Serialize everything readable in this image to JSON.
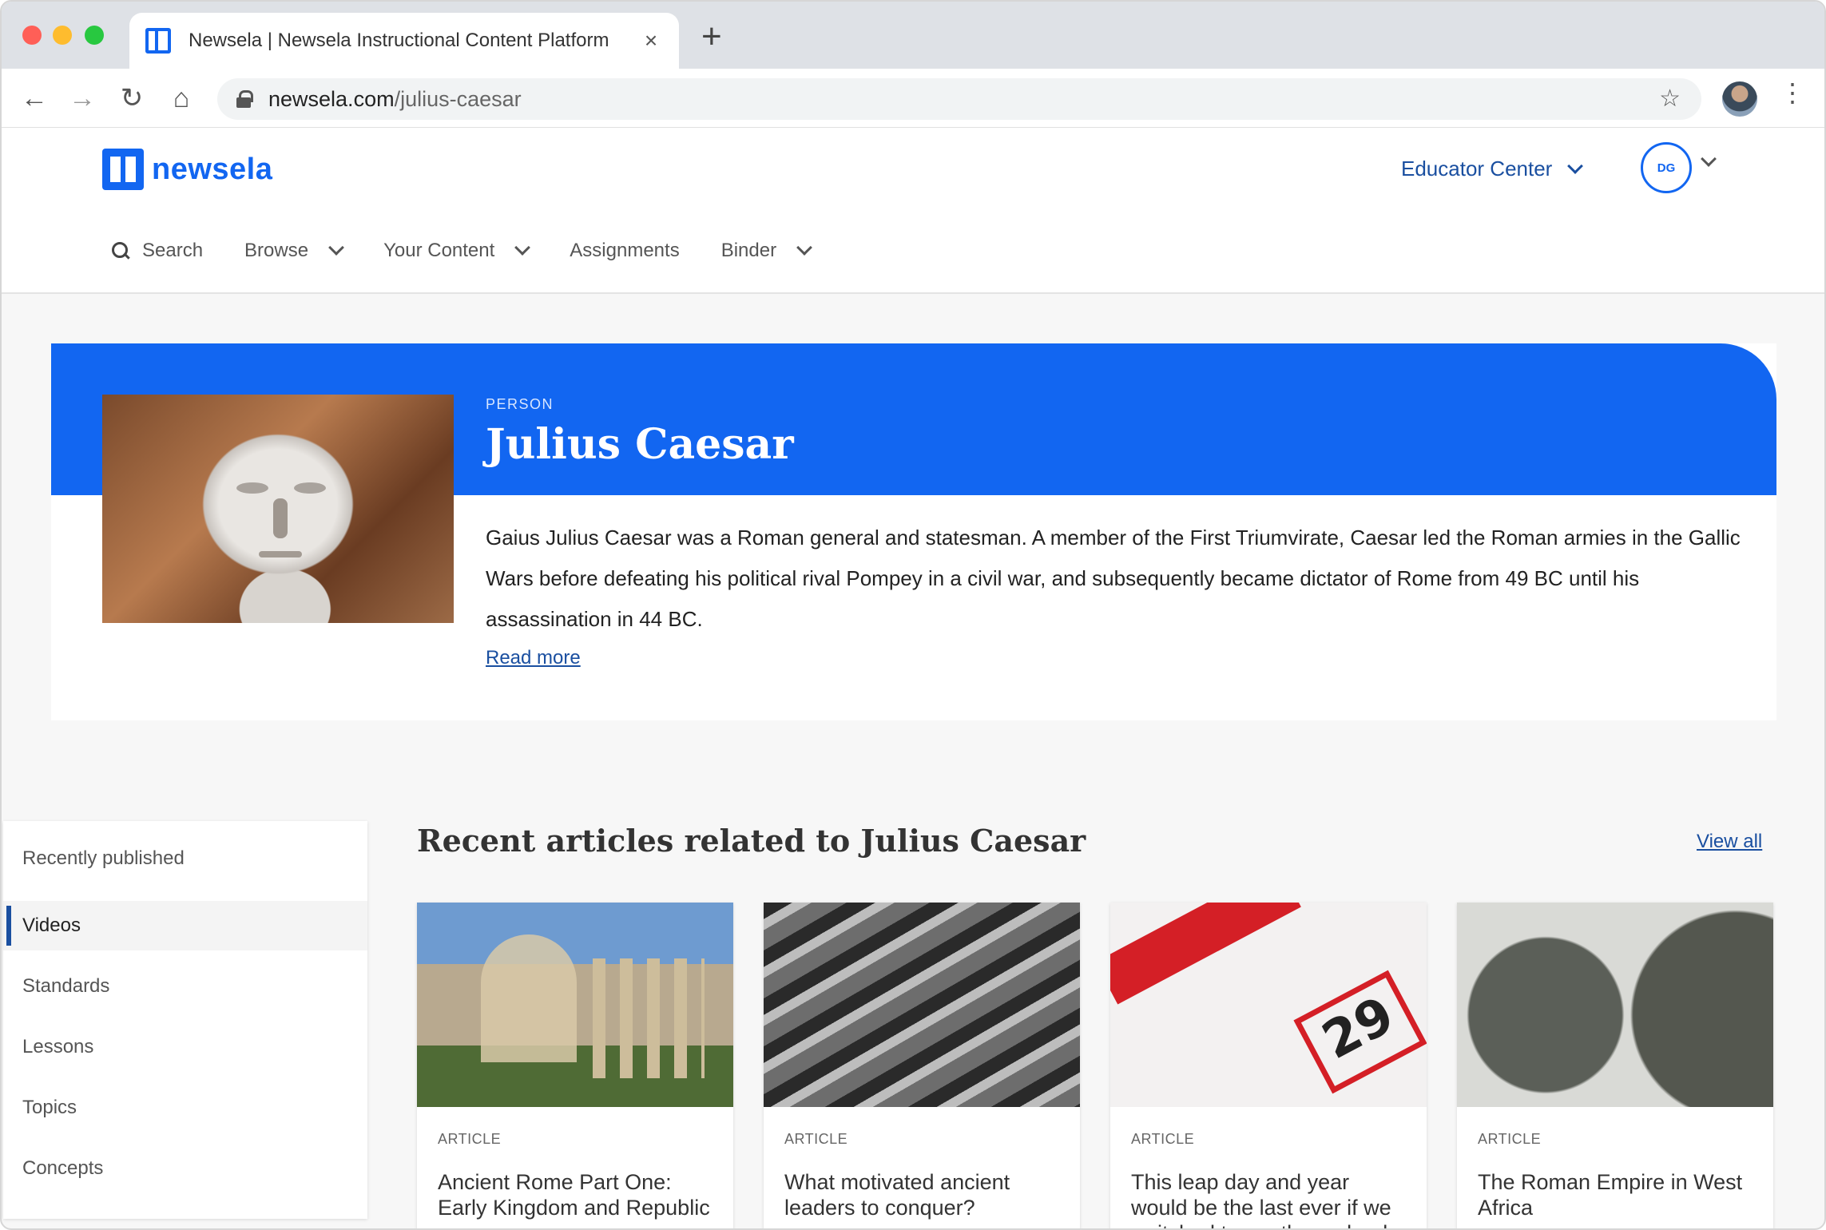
{
  "browser": {
    "tab_title": "Newsela | Newsela Instructional Content Platform",
    "tab_close": "×",
    "new_tab": "+",
    "url_host": "newsela.com",
    "url_path": "/julius-caesar"
  },
  "header": {
    "logo_text": "newsela",
    "educator_center": "Educator Center",
    "avatar_initials": "DG",
    "nav": {
      "search": "Search",
      "browse": "Browse",
      "your_content": "Your Content",
      "assignments": "Assignments",
      "binder": "Binder"
    }
  },
  "hero": {
    "kind": "PERSON",
    "title": "Julius Caesar",
    "description": "Gaius Julius Caesar was a Roman general and statesman. A member of the First Triumvirate, Caesar led the Roman armies in the Gallic Wars before defeating his political rival Pompey in a civil war, and subsequently became dictator of Rome from 49 BC until his assassination in 44 BC.",
    "read_more": "Read more"
  },
  "sidebar": {
    "items": [
      {
        "label": "Recently published",
        "active": false
      },
      {
        "label": "Videos",
        "active": true
      },
      {
        "label": "Standards",
        "active": false
      },
      {
        "label": "Lessons",
        "active": false
      },
      {
        "label": "Topics",
        "active": false
      },
      {
        "label": "Concepts",
        "active": false
      }
    ]
  },
  "articles": {
    "section_title": "Recent articles related to Julius Caesar",
    "view_all": "View all",
    "cards": [
      {
        "kind": "ARTICLE",
        "title": "Ancient Rome Part One: Early Kingdom and Republic",
        "image": "roman-forum-ruins"
      },
      {
        "kind": "ARTICLE",
        "title": "What motivated ancient leaders to conquer?",
        "image": "ancient-battle-scene"
      },
      {
        "kind": "ARTICLE",
        "title": "This leap day and year would be the last ever if we switched to another calendar",
        "image": "february-calendar"
      },
      {
        "kind": "ARTICLE",
        "title": "The Roman Empire in West Africa",
        "image": "roman-coins"
      }
    ]
  }
}
